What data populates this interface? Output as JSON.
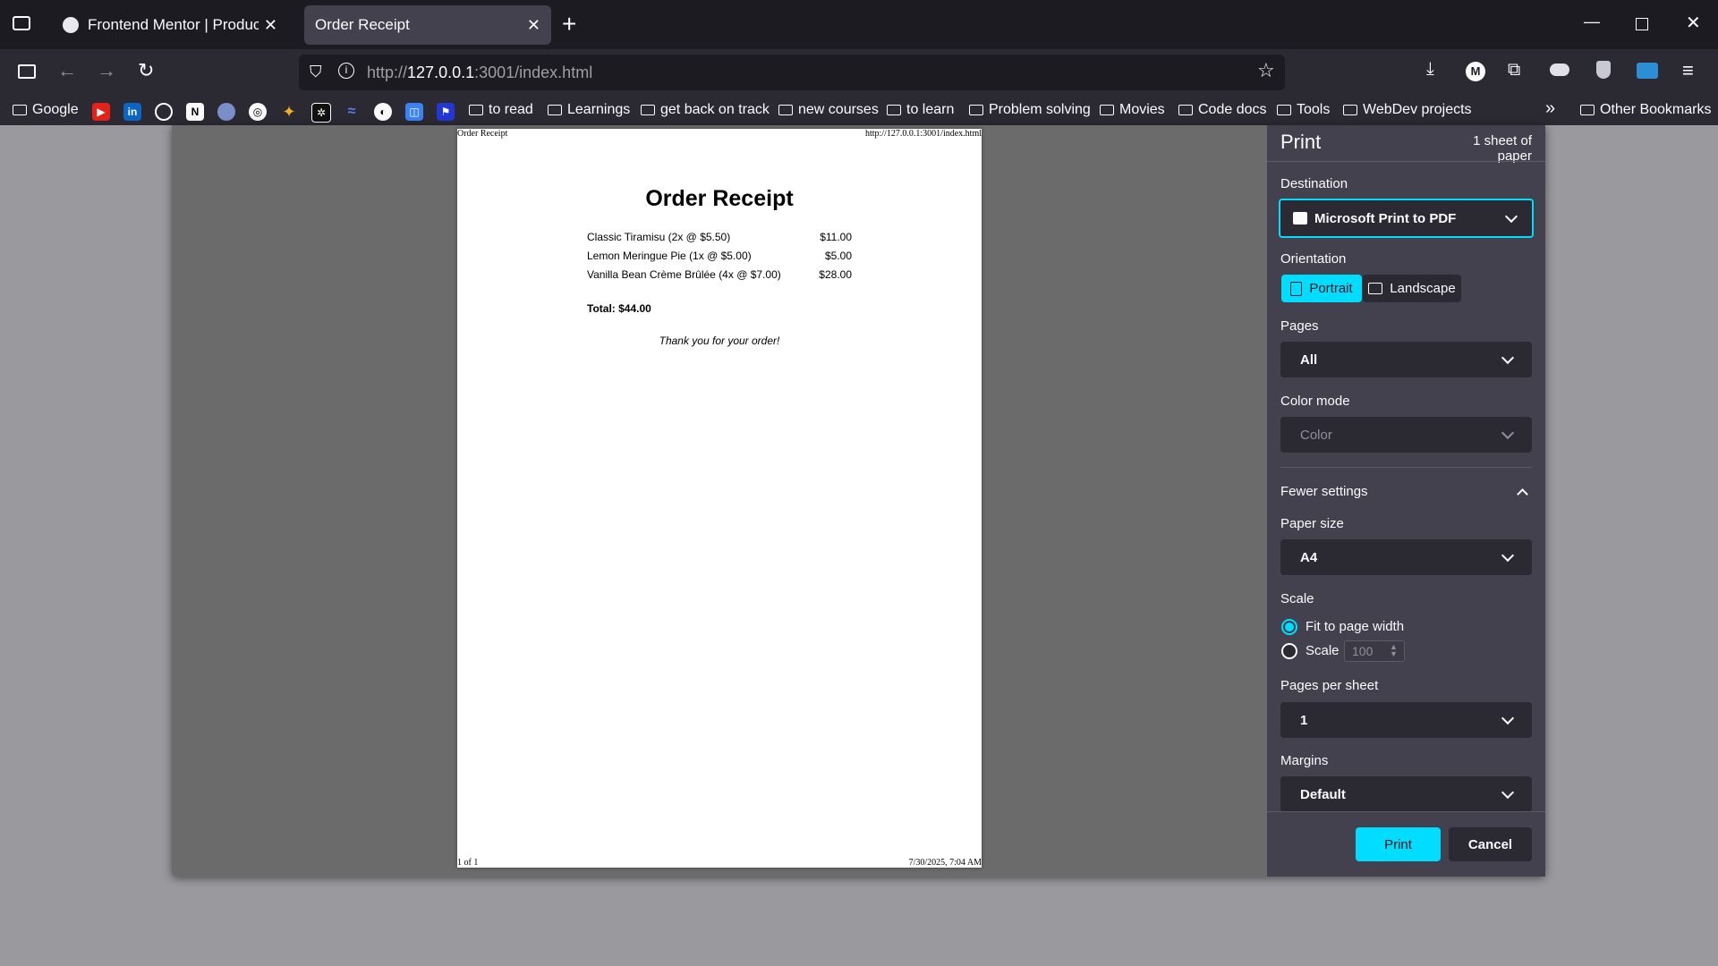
{
  "browser": {
    "tabs": [
      {
        "title": "Frontend Mentor | Product list w",
        "active": false
      },
      {
        "title": "Order Receipt",
        "active": true
      }
    ],
    "url_scheme": "http://",
    "url_host": "127.0.0.1",
    "url_rest": ":3001/index.html",
    "bookmarks": [
      "Google",
      "to read",
      "Learnings",
      "get back on track",
      "new courses",
      "to learn",
      "Problem solving",
      "Movies",
      "Code docs",
      "Tools",
      "WebDev projects",
      "Other Bookmarks"
    ],
    "account_initial": "M"
  },
  "preview": {
    "header_left": "Order Receipt",
    "header_right": "http://127.0.0.1:3001/index.html",
    "title": "Order Receipt",
    "items": [
      {
        "name": "Classic Tiramisu (2x @ $5.50)",
        "price": "$11.00"
      },
      {
        "name": "Lemon Meringue Pie (1x @ $5.00)",
        "price": "$5.00"
      },
      {
        "name": "Vanilla Bean Crème Brûlée (4x @ $7.00)",
        "price": "$28.00"
      }
    ],
    "total": "Total: $44.00",
    "thanks": "Thank you for your order!",
    "footer_left": "1 of 1",
    "footer_right": "7/30/2025, 7:04 AM"
  },
  "print": {
    "title": "Print",
    "sheets": "1 sheet of paper",
    "destination_label": "Destination",
    "destination": "Microsoft Print to PDF",
    "orientation_label": "Orientation",
    "portrait": "Portrait",
    "landscape": "Landscape",
    "pages_label": "Pages",
    "pages": "All",
    "color_label": "Color mode",
    "color": "Color",
    "fewer": "Fewer settings",
    "paper_label": "Paper size",
    "paper": "A4",
    "scale_label": "Scale",
    "fit": "Fit to page width",
    "scale_opt": "Scale",
    "scale_value": "100",
    "pps_label": "Pages per sheet",
    "pps": "1",
    "margins_label": "Margins",
    "margins": "Default",
    "print_btn": "Print",
    "cancel_btn": "Cancel"
  }
}
